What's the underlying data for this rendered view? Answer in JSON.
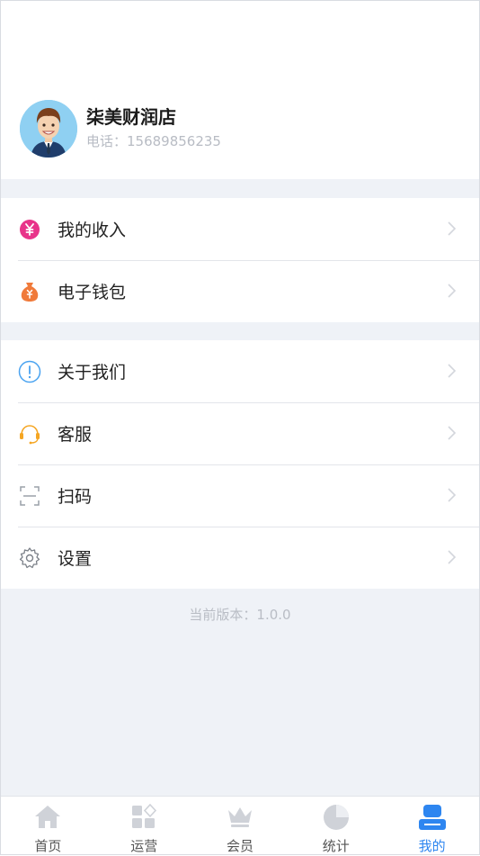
{
  "profile": {
    "shop_name": "柒美财润店",
    "phone": "电话：15689856235"
  },
  "menu_groups": [
    {
      "items": [
        {
          "label": "我的收入",
          "icon": "income-yen-icon"
        },
        {
          "label": "电子钱包",
          "icon": "money-bag-icon"
        }
      ]
    },
    {
      "items": [
        {
          "label": "关于我们",
          "icon": "info-icon"
        },
        {
          "label": "客服",
          "icon": "headset-icon"
        },
        {
          "label": "扫码",
          "icon": "scan-icon"
        },
        {
          "label": "设置",
          "icon": "gear-icon"
        }
      ]
    }
  ],
  "version_text": "当前版本：1.0.0",
  "tabbar": {
    "tabs": [
      {
        "label": "首页",
        "icon": "home-icon"
      },
      {
        "label": "运营",
        "icon": "apps-icon"
      },
      {
        "label": "会员",
        "icon": "crown-icon"
      },
      {
        "label": "统计",
        "icon": "pie-chart-icon"
      },
      {
        "label": "我的",
        "icon": "profile-icon"
      }
    ],
    "active_index": 4
  },
  "colors": {
    "accent": "#2e86f0",
    "income": "#e8348a",
    "wallet": "#f07a3a",
    "about": "#4aa3f0",
    "service": "#f5a623"
  }
}
